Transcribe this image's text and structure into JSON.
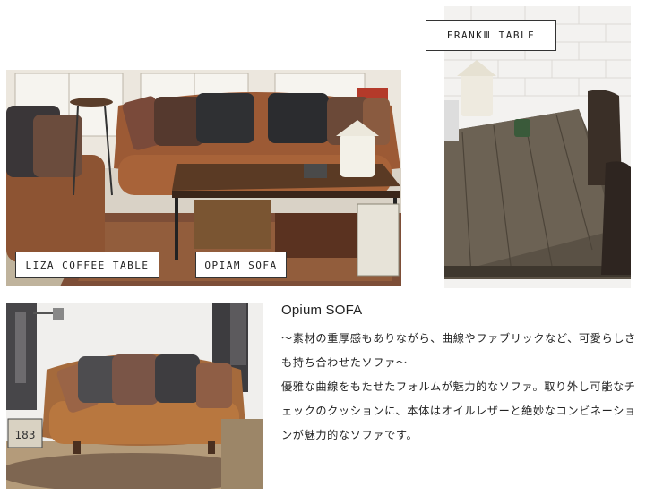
{
  "labels": {
    "liza": "LIZA COFFEE TABLE",
    "opium": "OPIAM SOFA",
    "frank": "FRANKⅢ TABLE"
  },
  "product": {
    "title": "Opium SOFA",
    "tagline_line1": "～素材の重厚感もありながら、曲線やファブリックなど、可愛らしさ",
    "tagline_line2": "も持ち合わせたソファ～",
    "body_line1": "優雅な曲線をもたせたフォルムが魅力的なソファ。取り外し可能なチ",
    "body_line2": "ェックのクッションに、本体はオイルレザーと絶妙なコンビネーショ",
    "body_line3": "ンが魅力的なソファです。"
  },
  "photo_sign_text": "183"
}
